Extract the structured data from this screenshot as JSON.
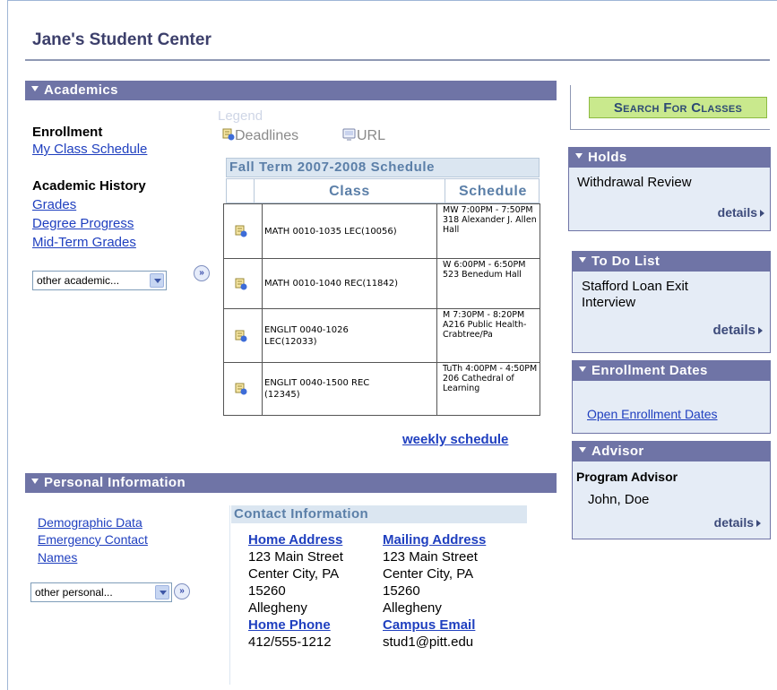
{
  "page": {
    "title": "Jane's Student Center"
  },
  "academics": {
    "header": "Academics",
    "enrollment": {
      "label": "Enrollment",
      "links": [
        "My Class Schedule"
      ]
    },
    "history": {
      "label": "Academic History",
      "links": [
        "Grades",
        "Degree Progress",
        "Mid-Term Grades"
      ]
    },
    "select_value": "other academic...",
    "legend": {
      "label": "Legend",
      "deadlines": "Deadlines",
      "url": "URL"
    },
    "schedule": {
      "title": "Fall Term 2007-2008 Schedule",
      "col_class": "Class",
      "col_schedule": "Schedule",
      "rows": [
        {
          "cls": "MATH 0010-1035 LEC(10056)",
          "when": "MW 7:00PM - 7:50PM 318 Alexander J. Allen Hall"
        },
        {
          "cls": "MATH 0010-1040 REC(11842)",
          "when": "W 6:00PM - 6:50PM 523 Benedum Hall"
        },
        {
          "cls": "ENGLIT 0040-1026 LEC(12033)",
          "when": "M 7:30PM - 8:20PM A216 Public Health-Crabtree/Pa"
        },
        {
          "cls": "ENGLIT 0040-1500 REC (12345)",
          "when": "TuTh 4:00PM - 4:50PM 206 Cathedral of Learning"
        }
      ],
      "weekly_link": "weekly schedule"
    }
  },
  "personal": {
    "header": "Personal Information",
    "links": [
      "Demographic Data",
      "Emergency Contact Names"
    ],
    "select_value": "other personal...",
    "contact": {
      "title": "Contact Information",
      "home_address": {
        "label": "Home Address",
        "line1": "123 Main Street",
        "line2": "Center City, PA",
        "line3": "15260",
        "line4": "Allegheny"
      },
      "mailing_address": {
        "label": "Mailing Address",
        "line1": "123 Main Street",
        "line2": "Center City, PA",
        "line3": "15260",
        "line4": "Allegheny"
      },
      "home_phone": {
        "label": "Home Phone",
        "value": "412/555-1212"
      },
      "campus_email": {
        "label": "Campus Email",
        "value": "stud1@pitt.edu"
      }
    }
  },
  "sidebar": {
    "search_button": "Search For Classes",
    "holds": {
      "header": "Holds",
      "item": "Withdrawal Review",
      "details": "details"
    },
    "todo": {
      "header": "To Do List",
      "item": "Stafford Loan Exit Interview",
      "details": "details"
    },
    "enrollment_dates": {
      "header": "Enrollment Dates",
      "link": "Open Enrollment Dates"
    },
    "advisor": {
      "header": "Advisor",
      "label": "Program Advisor",
      "name": "John, Doe",
      "details": "details"
    }
  },
  "colors": {
    "header_bg": "#6f74a6",
    "link": "#1f3fbf",
    "search_button_bg": "#c9e98d",
    "panel_bg": "#e5ecf6"
  },
  "icons": [
    "collapse-triangle-icon",
    "deadlines-icon",
    "url-icon",
    "go-arrow-icon",
    "details-arrow-icon"
  ]
}
